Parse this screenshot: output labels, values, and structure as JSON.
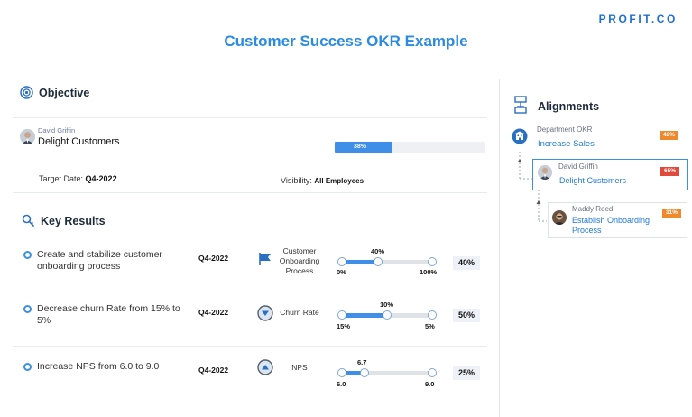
{
  "brand": "PROFIT.CO",
  "title": "Customer Success OKR Example",
  "objective": {
    "heading": "Objective",
    "owner": "David Griffin",
    "title": "Delight Customers",
    "progress_label": "38%",
    "progress": 0.38,
    "target_date_label": "Target Date:",
    "target_date": "Q4-2022",
    "visibility_label": "Visibility:",
    "visibility": "All Employees"
  },
  "key_results": {
    "heading": "Key Results",
    "items": [
      {
        "text": "Create and stabilize customer onboarding process",
        "date": "Q4-2022",
        "metric": "Customer Onboarding Process",
        "icon": "flag-icon",
        "current": "40%",
        "min": "0%",
        "max": "100%",
        "fraction": 0.4,
        "percent": "40%"
      },
      {
        "text": "Decrease churn Rate from 15% to 5%",
        "date": "Q4-2022",
        "metric": "Churn Rate",
        "icon": "arrow-down-icon",
        "current": "10%",
        "min": "15%",
        "max": "5%",
        "fraction": 0.5,
        "percent": "50%"
      },
      {
        "text": "Increase NPS from 6.0 to 9.0",
        "date": "Q4-2022",
        "metric": "NPS",
        "icon": "arrow-up-icon",
        "current": "6.7",
        "min": "6.0",
        "max": "9.0",
        "fraction": 0.25,
        "percent": "25%"
      }
    ]
  },
  "alignments": {
    "heading": "Alignments",
    "nodes": [
      {
        "label": "Department OKR",
        "title": "Increase Sales",
        "badge": "42%",
        "badge_color": "#f0892b"
      },
      {
        "label": "David Griffin",
        "title": "Delight Customers",
        "badge": "65%",
        "badge_color": "#e04a3b"
      },
      {
        "label": "Maddy Reed",
        "title": "Establish Onboarding Process",
        "badge": "31%",
        "badge_color": "#f0892b"
      }
    ]
  }
}
